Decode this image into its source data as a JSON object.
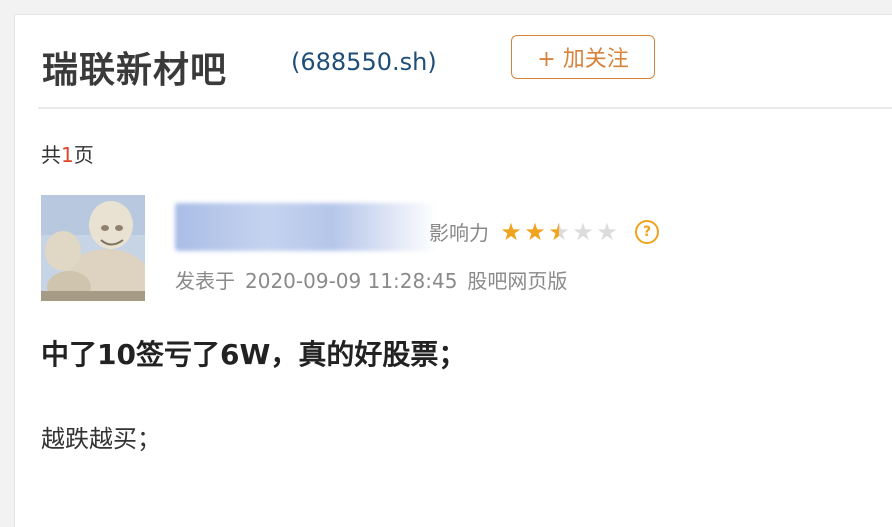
{
  "header": {
    "bar_name": "瑞联新材吧",
    "stock_code": "(688550.sh)",
    "follow_label": "+ 加关注"
  },
  "pagination": {
    "prefix": "共",
    "count": "1",
    "suffix": "页"
  },
  "post": {
    "influence_label": "影响力",
    "influence_rating": 2.5,
    "influence_max": 5,
    "help_icon": "question-circle-icon",
    "posted_label": "发表于",
    "datetime": "2020-09-09 11:28:45",
    "source": "股吧网页版",
    "title": "中了10签亏了6W，真的好股票；",
    "body": "越跌越买；"
  },
  "colors": {
    "accent": "#d8833c",
    "star": "#f0a31d",
    "page_number": "#e0452a",
    "stock_code": "#1f4e79"
  }
}
